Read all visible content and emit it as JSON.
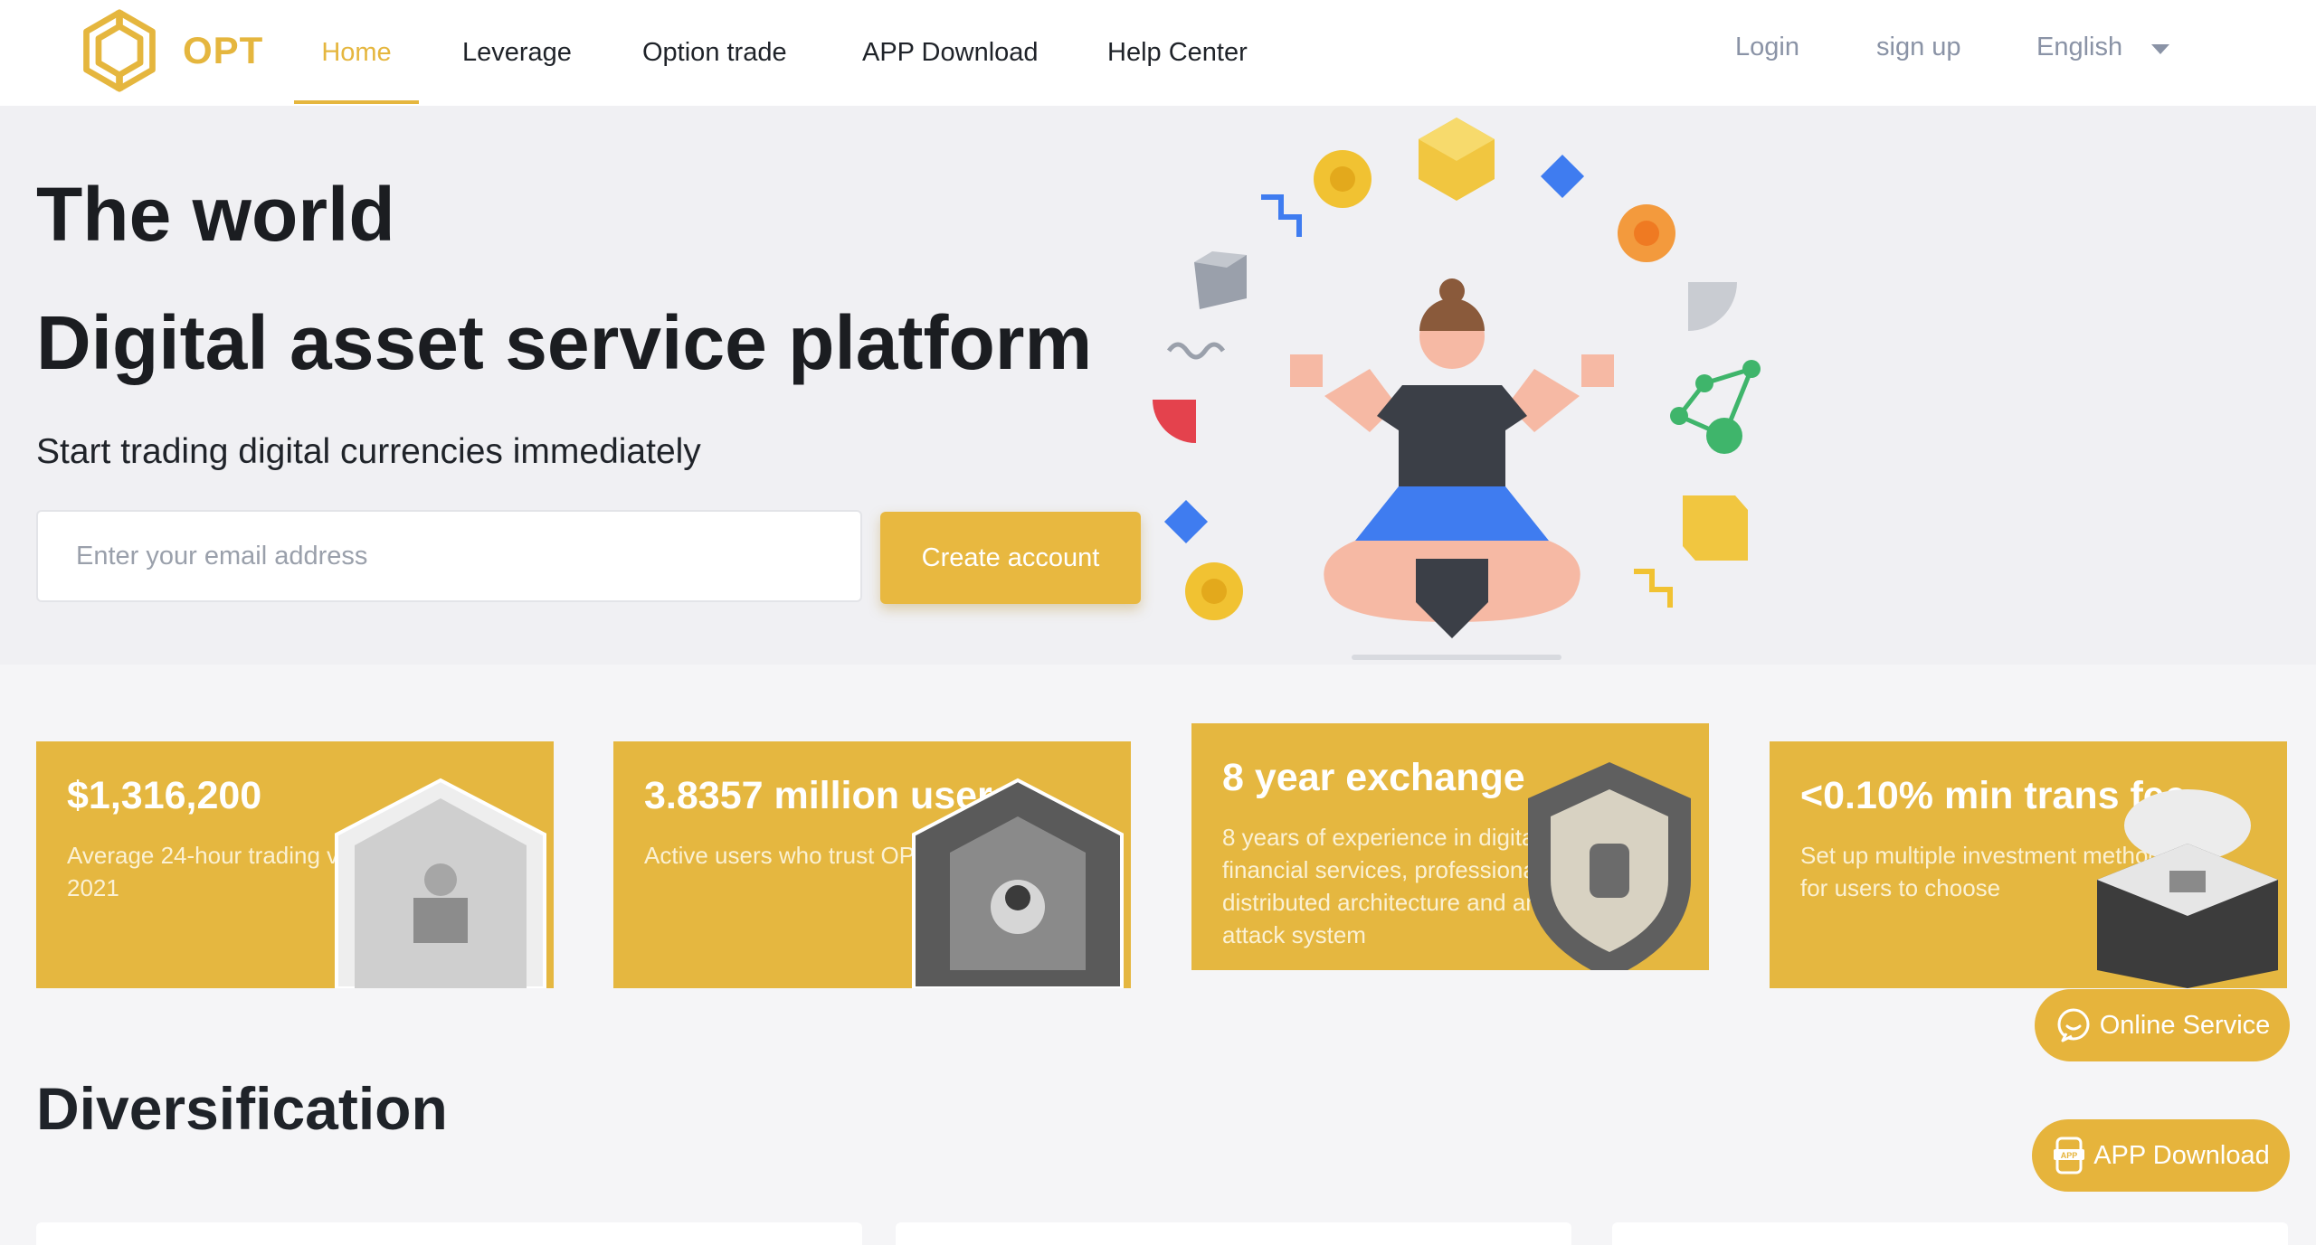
{
  "brand": {
    "name": "OPT",
    "accent": "#e5b63e"
  },
  "nav": {
    "items": [
      {
        "label": "Home",
        "active": true
      },
      {
        "label": "Leverage",
        "active": false
      },
      {
        "label": "Option trade",
        "active": false
      },
      {
        "label": "APP Download",
        "active": false
      },
      {
        "label": "Help Center",
        "active": false
      }
    ]
  },
  "header": {
    "login": "Login",
    "signup": "sign up",
    "language": "English"
  },
  "hero": {
    "title_line1": "The world",
    "title_line2": "Digital asset service platform",
    "subtitle": "Start trading digital currencies immediately",
    "email_placeholder": "Enter your email address",
    "email_value": "",
    "cta": "Create account"
  },
  "stats": [
    {
      "title": "$1,316,200",
      "desc": "Average 24-hour trading volume in 2021"
    },
    {
      "title": "3.8357 million users",
      "desc": "Active users who trust OPT"
    },
    {
      "title": "8 year exchange",
      "desc": "8 years of experience in digital asset financial services, professional distributed architecture and anti DDOS attack system"
    },
    {
      "title": "<0.10% min trans fee",
      "desc": "Set up multiple investment methods for users to choose"
    }
  ],
  "section": {
    "title": "Diversification"
  },
  "floating": {
    "online_service": "Online Service",
    "app_download": "APP Download"
  }
}
